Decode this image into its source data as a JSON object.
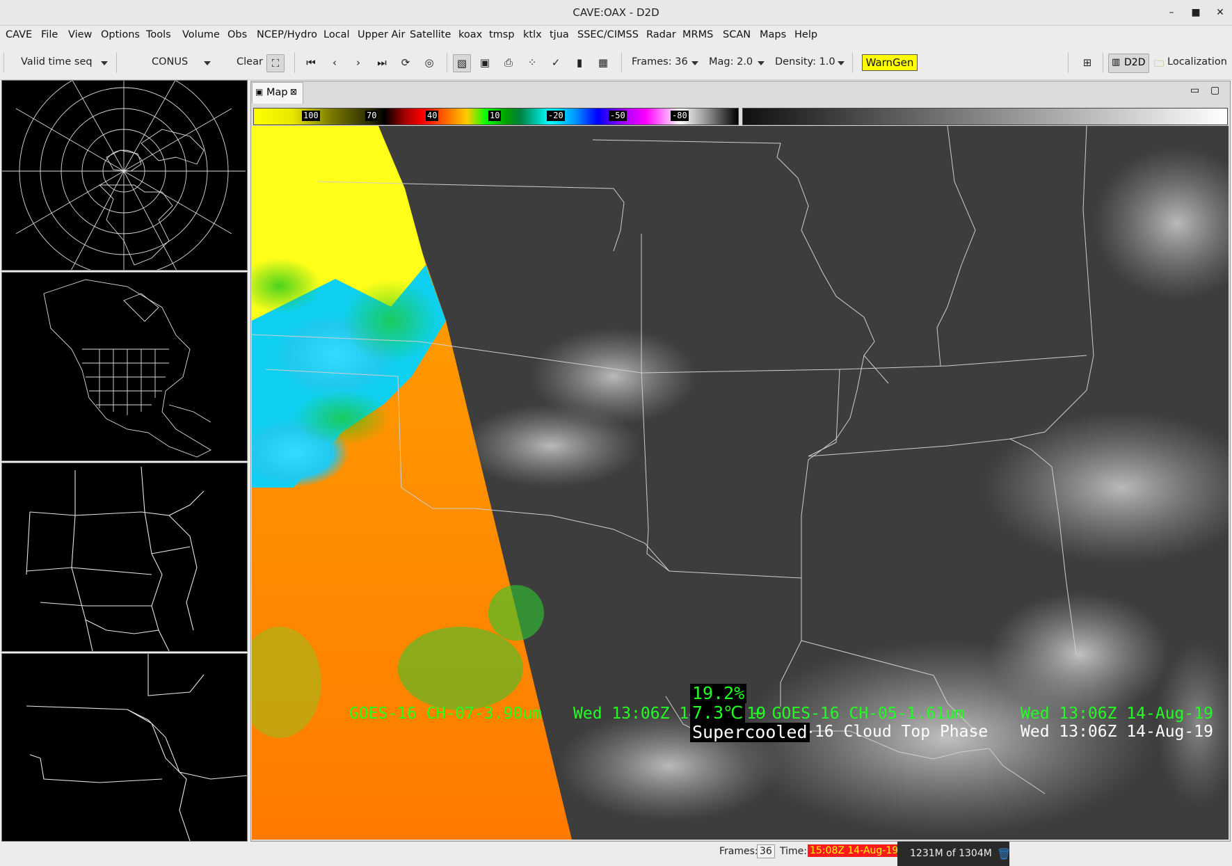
{
  "window": {
    "title": "CAVE:OAX - D2D",
    "minimize": "–",
    "maximize": "■",
    "close": "✕"
  },
  "menu": [
    "CAVE",
    "File",
    "View",
    "Options",
    "Tools",
    "Volume",
    "Obs",
    "NCEP/Hydro",
    "Local",
    "Upper Air",
    "Satellite",
    "koax",
    "tmsp",
    "ktlx",
    "tjua",
    "SSEC/CIMSS",
    "Radar",
    "MRMS",
    "SCAN",
    "Maps",
    "Help"
  ],
  "toolbar": {
    "time_mode": "Valid time seq",
    "scale": "CONUS",
    "clear": "Clear",
    "frames": "Frames: 36",
    "mag": "Mag: 2.0",
    "density": "Density: 1.0",
    "warngen": "WarnGen",
    "perspective_d2d": "D2D",
    "perspective_localization": "Localization"
  },
  "map_tab": {
    "label": "Map"
  },
  "colorbar": {
    "labels": [
      "100",
      "70",
      "40",
      "10",
      "-20",
      "-50",
      "-80"
    ]
  },
  "overlay": {
    "line1_product": "GOES-16 CH-07-3.90um",
    "line1_time": "Wed 13:06Z 14-Aug-19",
    "line1_plus": "+ GOES-16 CH-05-1.61um",
    "line1_time2": "Wed 13:06Z 14-Aug-19",
    "line2_product": "* GOES-16 Cloud Top Phase",
    "line2_time": "Wed 13:06Z 14-Aug-19"
  },
  "sample": {
    "reflectance": "19.2%",
    "temperature": "7.3℃",
    "phase": "Supercooled"
  },
  "status": {
    "frames_label": "Frames:",
    "frames_value": "36",
    "time_label": "Time:",
    "time_value": "15:08Z 14-Aug-19",
    "memory": "1231M of 1304M"
  },
  "colors": {
    "accent_green": "#22ff22",
    "time_red": "#ff1a1a",
    "warngen_yellow": "#ffff00"
  }
}
